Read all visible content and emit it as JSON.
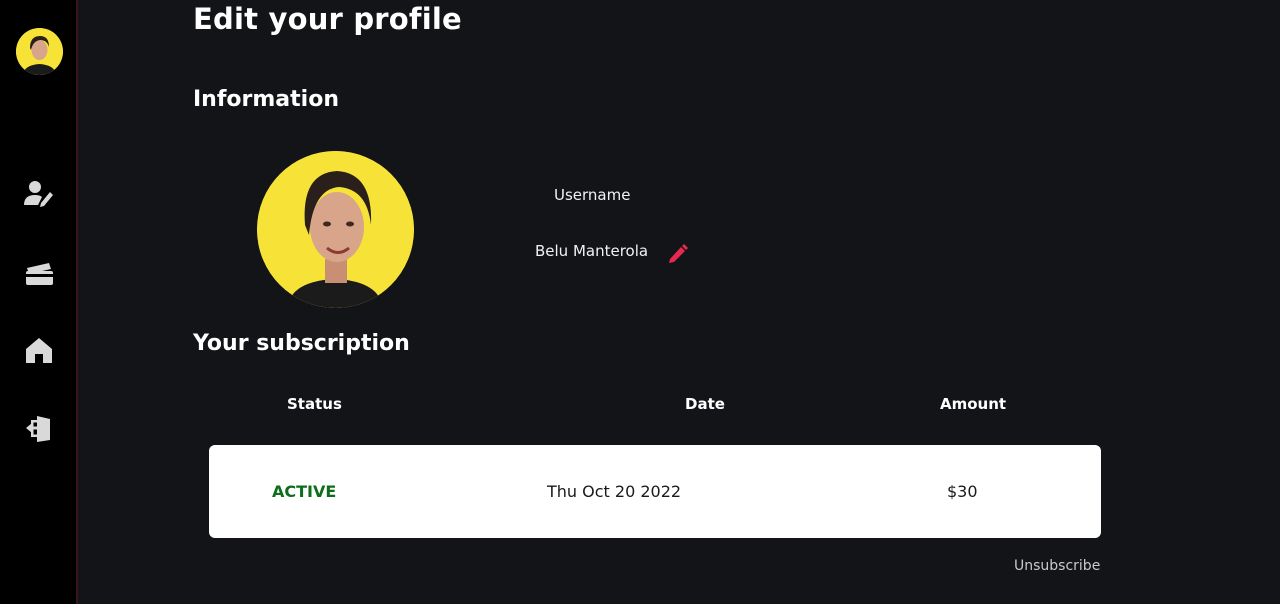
{
  "sidebar": {
    "icons": [
      "avatar",
      "user-edit-icon",
      "credit-card-icon",
      "home-icon",
      "logout-icon"
    ]
  },
  "page": {
    "title": "Edit your profile"
  },
  "information": {
    "title": "Information",
    "username_label": "Username",
    "username_value": "Belu Manterola"
  },
  "subscription": {
    "title": "Your subscription",
    "columns": [
      "Status",
      "Date",
      "Amount"
    ],
    "row": {
      "status": "ACTIVE",
      "date": "Thu Oct 20 2022",
      "amount": "$30"
    },
    "unsubscribe_label": "Unsubscribe"
  },
  "colors": {
    "background": "#131418",
    "sidebar": "#000000",
    "accent": "#e8294f",
    "avatar_bg": "#f7e338",
    "status_active": "#0e6d1a"
  }
}
